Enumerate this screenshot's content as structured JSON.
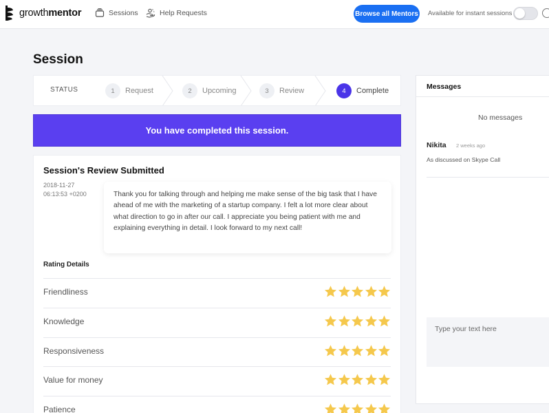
{
  "brand": {
    "name_regular": "growth",
    "name_bold": "mentor"
  },
  "nav": {
    "sessions_label": "Sessions",
    "help_requests_label": "Help Requests",
    "browse_button": "Browse all Mentors",
    "availability_label": "Available for instant sessions",
    "availability_on": false
  },
  "page": {
    "title": "Session"
  },
  "status": {
    "label": "STATUS",
    "steps": [
      {
        "num": "1",
        "label": "Request",
        "active": false
      },
      {
        "num": "2",
        "label": "Upcoming",
        "active": false
      },
      {
        "num": "3",
        "label": "Review",
        "active": false
      },
      {
        "num": "4",
        "label": "Complete",
        "active": true
      }
    ]
  },
  "banner": {
    "text": "You have completed this session."
  },
  "review": {
    "title": "Session's Review Submitted",
    "date": "2018-11-27",
    "time": "06:13:53 +0200",
    "text": "Thank you for talking through and helping me make sense of the big task that I have ahead of me with the marketing of a startup company. I felt a lot more clear about what direction to go in after our call. I appreciate you being patient with me and explaining everything in detail. I look forward to my next call!",
    "rating_title": "Rating Details",
    "ratings": [
      {
        "name": "Friendliness",
        "stars": 5
      },
      {
        "name": "Knowledge",
        "stars": 5
      },
      {
        "name": "Responsiveness",
        "stars": 5
      },
      {
        "name": "Value for money",
        "stars": 5
      },
      {
        "name": "Patience",
        "stars": 5
      }
    ]
  },
  "messages": {
    "title": "Messages",
    "empty_text": "No messages",
    "latest": {
      "author": "Nikita",
      "time": "2 weeks ago",
      "body": "As discussed on Skype Call"
    },
    "input_placeholder": "Type your text here"
  },
  "colors": {
    "accent": "#5a3ff0",
    "step_active": "#4a34e8",
    "button_blue": "#1a6ff2",
    "star": "#f5c84c"
  }
}
